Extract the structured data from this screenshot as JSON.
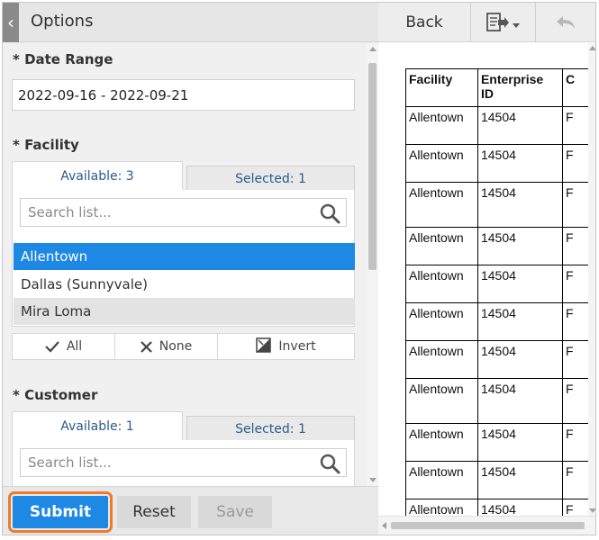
{
  "options_panel": {
    "title": "Options",
    "date_range": {
      "label": "* Date Range",
      "value": "2022-09-16 - 2022-09-21"
    },
    "facility": {
      "label": "* Facility",
      "tab_available": "Available: 3",
      "tab_selected": "Selected: 1",
      "search_placeholder": "Search list...",
      "items": [
        "Allentown",
        "Dallas (Sunnyvale)",
        "Mira Loma"
      ],
      "selected_item": "Allentown",
      "actions": {
        "all": "All",
        "none": "None",
        "invert": "Invert"
      }
    },
    "customer": {
      "label": "* Customer",
      "tab_available": "Available: 1",
      "tab_selected": "Selected: 1",
      "search_placeholder": "Search list..."
    },
    "buttons": {
      "submit": "Submit",
      "reset": "Reset",
      "save": "Save"
    }
  },
  "viewer": {
    "back_label": "Back",
    "export_icon": "export-icon",
    "undo_icon": "undo-icon",
    "table": {
      "headers": [
        "Facility",
        "Enterprise ID",
        "C"
      ],
      "rows": [
        [
          "Allentown",
          "14504",
          "F"
        ],
        [
          "Allentown",
          "14504",
          "F"
        ],
        [
          "Allentown",
          "14504",
          "F"
        ],
        [
          "Allentown",
          "14504",
          "F"
        ],
        [
          "Allentown",
          "14504",
          "F"
        ],
        [
          "Allentown",
          "14504",
          "F"
        ],
        [
          "Allentown",
          "14504",
          "F"
        ],
        [
          "Allentown",
          "14504",
          "F"
        ],
        [
          "Allentown",
          "14504",
          "F"
        ],
        [
          "Allentown",
          "14504",
          "F"
        ],
        [
          "Allentown",
          "14504",
          "F"
        ]
      ]
    }
  },
  "colors": {
    "accent": "#1e88e5",
    "highlight_outline": "#f07a2c",
    "panel_bg": "#f0f0f0",
    "link_text": "#2a5b8a"
  }
}
